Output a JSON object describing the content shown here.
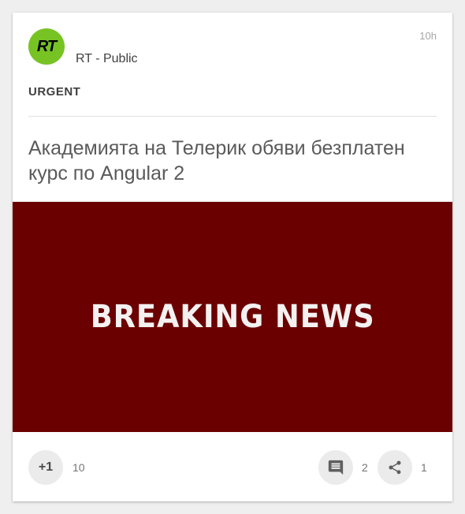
{
  "post": {
    "avatar_text": "RT",
    "author": "RT - Public",
    "time": "10h",
    "tag": "URGENT",
    "headline": "Академията на Телерик обяви безплатен курс по Angular 2",
    "image_text": "BREAKING NEWS"
  },
  "actions": {
    "plus_label": "+1",
    "plus_count": "10",
    "comment_icon": "comment-icon",
    "comment_count": "2",
    "share_icon": "share-icon",
    "share_count": "1"
  },
  "colors": {
    "avatar_bg": "#77c324",
    "banner_bg": "#6b0000",
    "button_bg": "#ebebeb"
  }
}
